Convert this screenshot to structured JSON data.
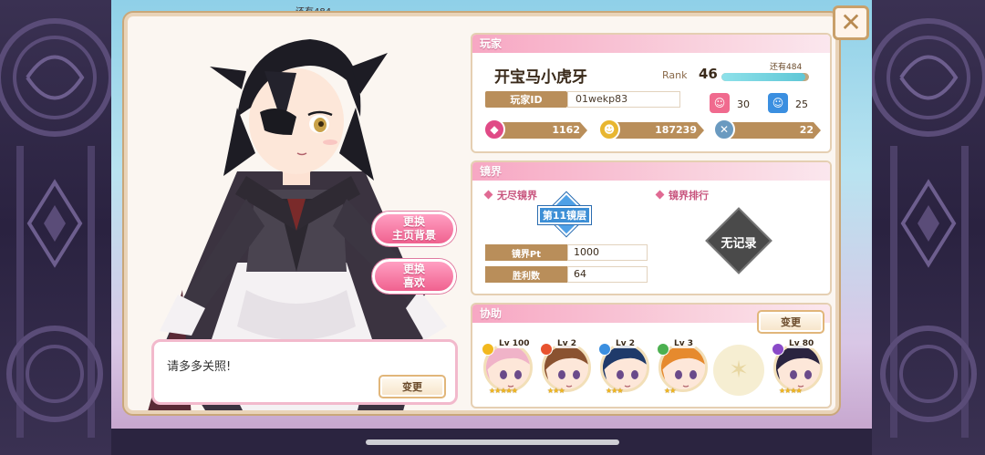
{
  "background": {
    "top_hint": "还有484"
  },
  "modal": {
    "close_label": "✕",
    "buttons": {
      "change_background": [
        "更换",
        "主页背景"
      ],
      "change_favorite": [
        "更换",
        "喜欢"
      ]
    },
    "speech": {
      "text": "请多多关照!",
      "change_label": "变更"
    }
  },
  "player": {
    "header": "玩家",
    "name": "开宝马小虎牙",
    "rank_label": "Rank",
    "rank": "46",
    "exp_remaining": "还有484",
    "exp_fill": 0.96,
    "id_label": "玩家ID",
    "id_value": "01wekp83",
    "pink_badge_count": "30",
    "blue_badge_count": "25",
    "currencies": [
      {
        "icon": "magic-stone-icon",
        "value": "1162"
      },
      {
        "icon": "gold-coin-icon",
        "value": "187239"
      },
      {
        "icon": "crystal-icon",
        "value": "22"
      }
    ]
  },
  "mirrors": {
    "header": "镜界",
    "endless_title": "无尽镜界",
    "ranking_title": "镜界排行",
    "floor": "第11镜层",
    "pt_label": "镜界Pt",
    "pt_value": "1000",
    "wins_label": "胜利数",
    "wins_value": "64",
    "no_record": "无记录"
  },
  "support": {
    "header": "协助",
    "change_label": "变更",
    "cards": [
      {
        "lv": "Lv 100",
        "stars": "★★★★★",
        "attr": "light",
        "attr_color": "#f2b81e",
        "hair": "#f0b3c8",
        "skin": "#fde7d9"
      },
      {
        "lv": "Lv 2",
        "stars": "★★★",
        "attr": "fire",
        "attr_color": "#e8532f",
        "hair": "#8a5230",
        "skin": "#fde7d9"
      },
      {
        "lv": "Lv 2",
        "stars": "★★★",
        "attr": "water",
        "attr_color": "#3b8fe0",
        "hair": "#1f3a6a",
        "skin": "#fde7d9"
      },
      {
        "lv": "Lv 3",
        "stars": "★★",
        "attr": "forest",
        "attr_color": "#4cb050",
        "hair": "#e68a2e",
        "skin": "#fde7d9"
      },
      {
        "lv": "Lv 80",
        "stars": "★★★★",
        "attr": "dark",
        "attr_color": "#8a4ac8",
        "hair": "#2a2440",
        "skin": "#fde7d9"
      }
    ]
  }
}
